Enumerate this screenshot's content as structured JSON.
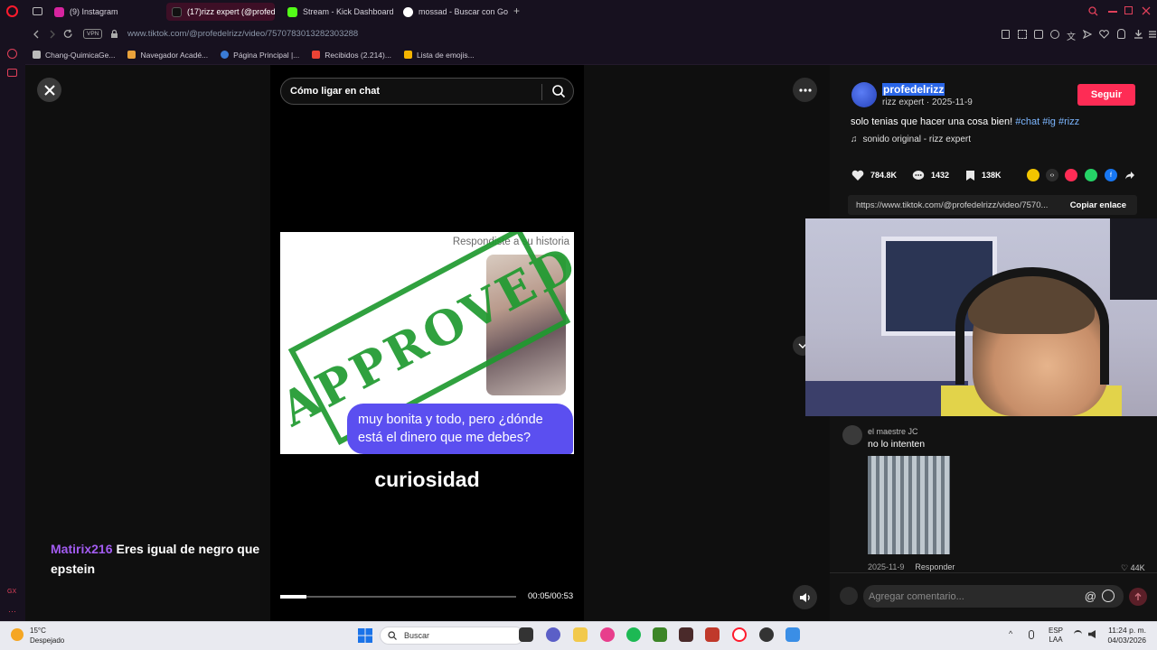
{
  "browser": {
    "tabs": [
      {
        "label": "(9) Instagram",
        "color": "#d6249f",
        "active": false
      },
      {
        "label": "(17)rizz expert (@profede",
        "color": "#111111",
        "active": true
      },
      {
        "label": "Stream - Kick Dashboard",
        "color": "#53fc18",
        "active": false
      },
      {
        "label": "mossad - Buscar con Goo",
        "color": "#4285f4",
        "active": false
      }
    ],
    "new_tab": "+",
    "vpn_badge": "VPN",
    "url": "www.tiktok.com/@profedelrizz/video/7570783013282303288",
    "bookmarks": [
      {
        "label": "Chang-QuimicaGe...",
        "color": "#bbbbbb"
      },
      {
        "label": "Navegador Acadé...",
        "color": "#e9a23b"
      },
      {
        "label": "Página Principal |...",
        "color": "#3a7bd5"
      },
      {
        "label": "Recibidos (2.214)...",
        "color": "#ea4335"
      },
      {
        "label": "Lista de emojis...",
        "color": "#f4b400"
      }
    ]
  },
  "video": {
    "search_placeholder": "Cómo ligar en chat",
    "story_label": "Respondiste a su historia",
    "stamp_text": "APPROVED",
    "bubble_text": "muy bonita y todo, pero ¿dónde está el dinero que me debes?",
    "caption": "curiosidad",
    "time": "00:05/00:53",
    "progress_fraction": 0.11
  },
  "chat_overlay": {
    "username": "Matirix216",
    "message": "Eres igual de negro que epstein"
  },
  "info": {
    "username": "profedelrizz",
    "subline": "rizz expert · 2025-11-9",
    "follow_label": "Seguir",
    "description": "solo tenias que hacer una cosa bien!",
    "hashtags": [
      "#chat",
      "#ig",
      "#rizz"
    ],
    "sound": "sonido original - rizz expert",
    "likes": "784.8K",
    "comments": "1432",
    "saves": "138K",
    "link": "https://www.tiktok.com/@profedelrizz/video/7570...",
    "copy_label": "Copiar enlace"
  },
  "comment": {
    "author": "el maestre JC",
    "text": "no lo intenten",
    "date": "2025-11-9",
    "reply_label": "Responder",
    "likes": "44K"
  },
  "comment_input": {
    "placeholder": "Agregar comentario..."
  },
  "taskbar": {
    "temperature": "15°C",
    "condition": "Despejado",
    "search_label": "Buscar",
    "lang_top": "ESP",
    "lang_bottom": "LAA",
    "time": "11:24 p. m.",
    "date": "04/03/2026"
  },
  "colors": {
    "accent": "#fe2c55",
    "hashtag": "#7cb6ff",
    "chat_user": "#a35cf2",
    "stamp": "#1f9a2f",
    "bubble": "#5b4ff0"
  }
}
